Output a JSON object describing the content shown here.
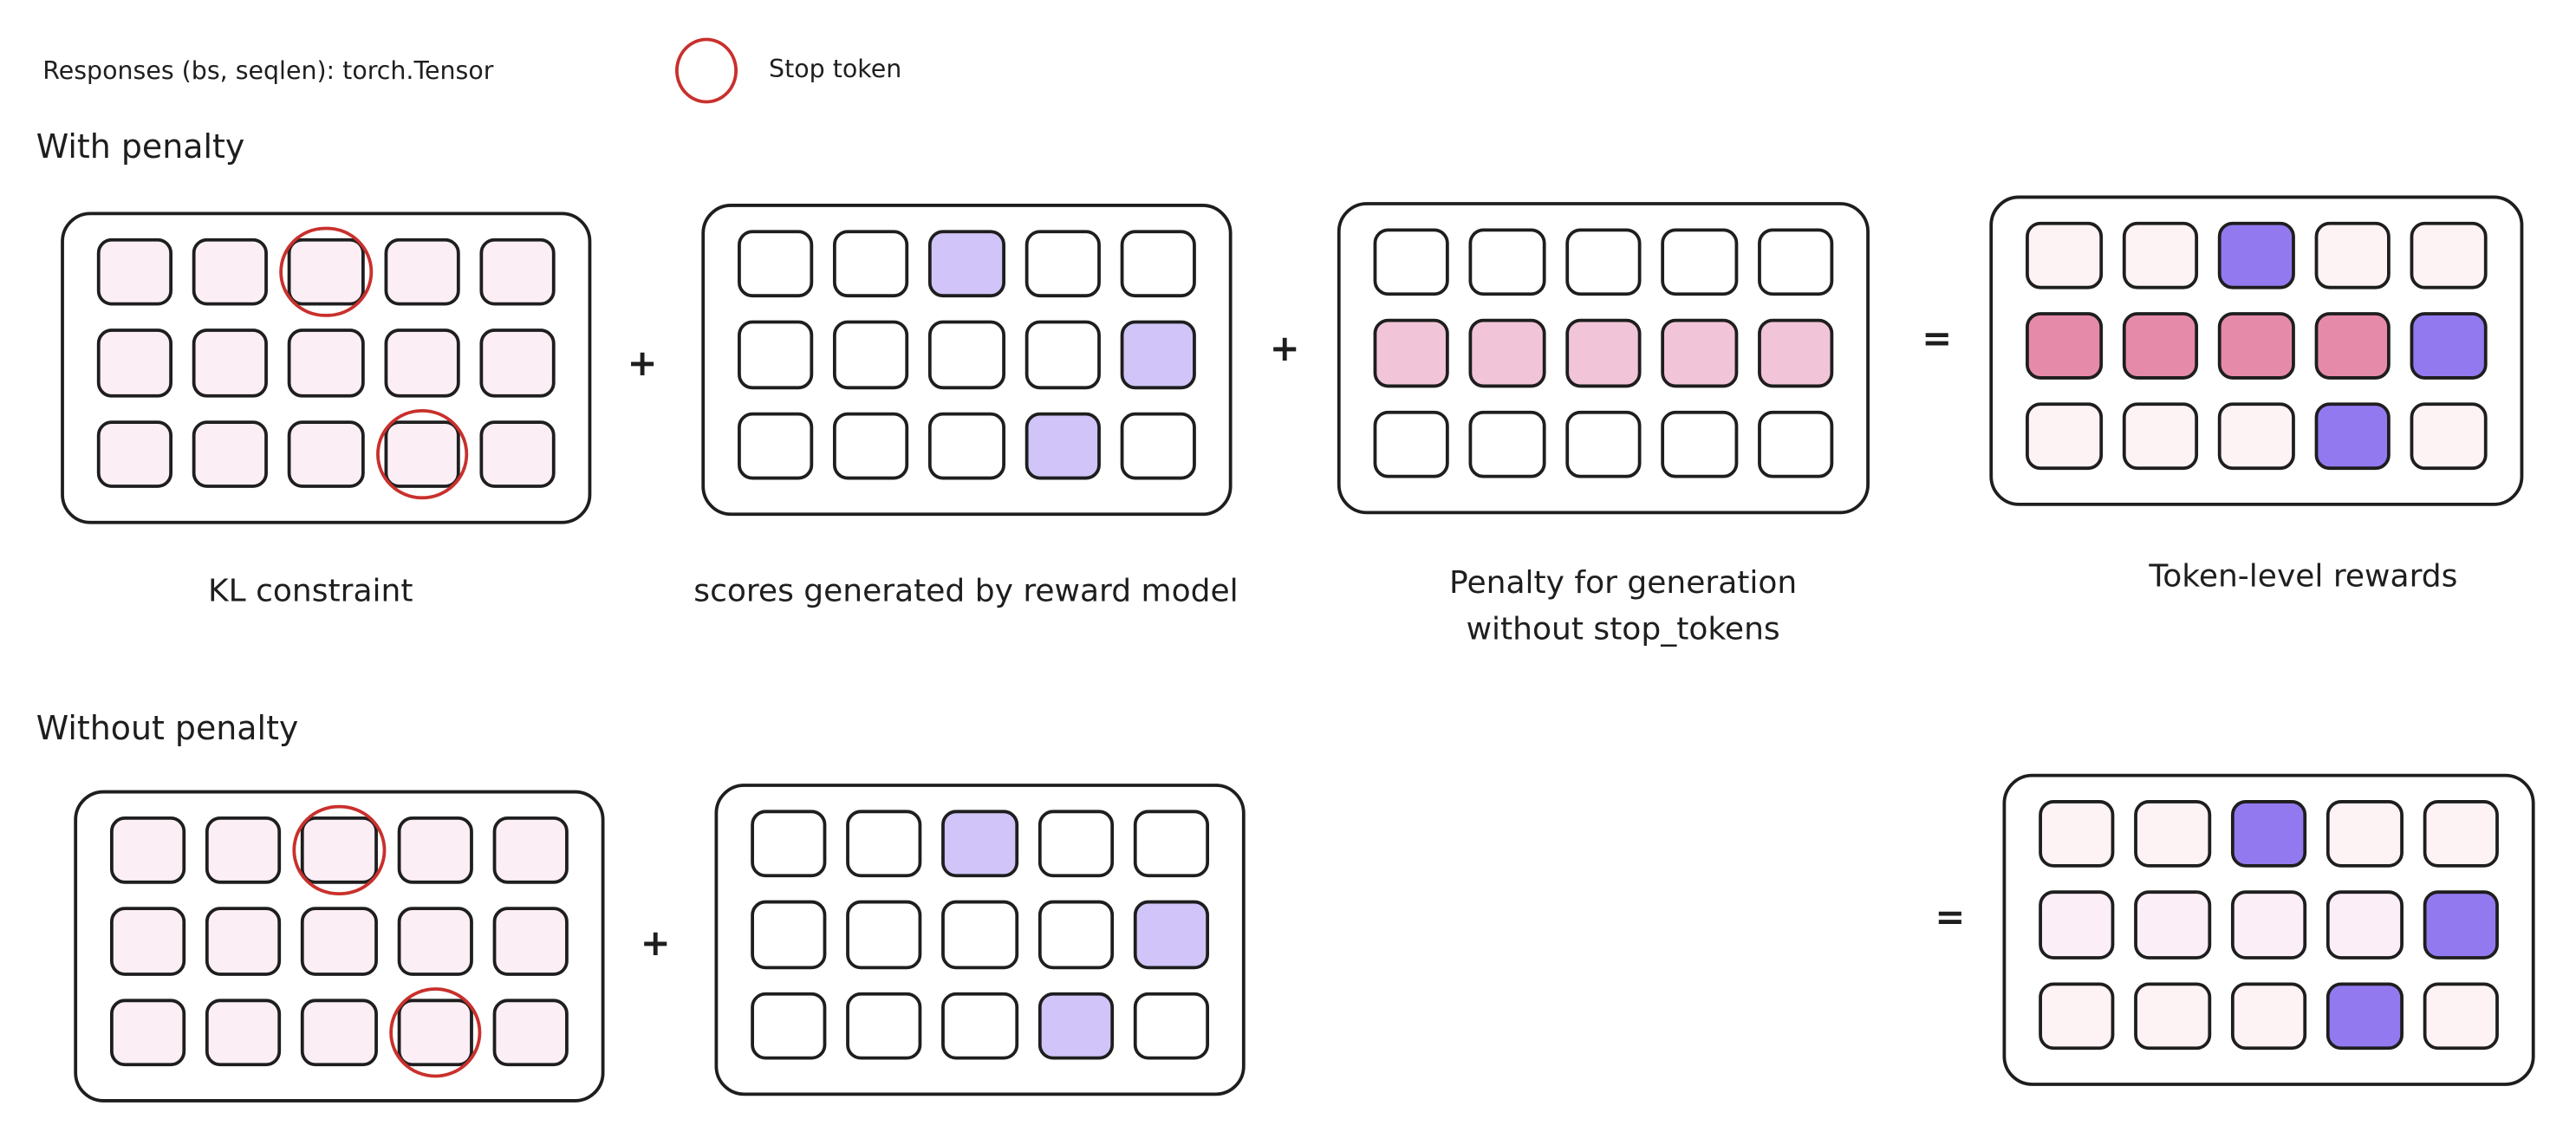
{
  "legend": {
    "responses_label": "Responses (bs, seqlen): torch.Tensor",
    "stop_token_label": "Stop token",
    "stop_token_icon": "red-circle",
    "stop_color": "#c9302c"
  },
  "colors": {
    "kl": "#fbeef5",
    "empty": "#ffffff",
    "score": "#d0c4f8",
    "penalty": "#f2c4d8",
    "reward_neg": "#e68aa9",
    "reward_pos": "#9379f0",
    "reward_small": "#fdf2f4",
    "reward_light": "#fbeef6"
  },
  "sections": [
    {
      "title": "With penalty",
      "operators": [
        "+",
        "+",
        "="
      ],
      "captions": [
        "KL constraint",
        "scores generated by reward model",
        "Penalty for generation\nwithout stop_tokens",
        "Token-level rewards"
      ],
      "grids": [
        {
          "name": "kl-constraint",
          "cells": [
            [
              "kl",
              "kl",
              "kl",
              "kl",
              "kl"
            ],
            [
              "kl",
              "kl",
              "kl",
              "kl",
              "kl"
            ],
            [
              "kl",
              "kl",
              "kl",
              "kl",
              "kl"
            ]
          ],
          "stops": [
            [
              0,
              2
            ],
            [
              2,
              3
            ]
          ]
        },
        {
          "name": "reward-model-scores",
          "cells": [
            [
              "empty",
              "empty",
              "score",
              "empty",
              "empty"
            ],
            [
              "empty",
              "empty",
              "empty",
              "empty",
              "score"
            ],
            [
              "empty",
              "empty",
              "empty",
              "score",
              "empty"
            ]
          ],
          "stops": []
        },
        {
          "name": "stop-token-penalty",
          "cells": [
            [
              "empty",
              "empty",
              "empty",
              "empty",
              "empty"
            ],
            [
              "penalty",
              "penalty",
              "penalty",
              "penalty",
              "penalty"
            ],
            [
              "empty",
              "empty",
              "empty",
              "empty",
              "empty"
            ]
          ],
          "stops": []
        },
        {
          "name": "token-level-rewards",
          "cells": [
            [
              "reward_small",
              "reward_small",
              "reward_pos",
              "reward_small",
              "reward_small"
            ],
            [
              "reward_neg",
              "reward_neg",
              "reward_neg",
              "reward_neg",
              "reward_pos"
            ],
            [
              "reward_small",
              "reward_small",
              "reward_small",
              "reward_pos",
              "reward_small"
            ]
          ],
          "stops": []
        }
      ]
    },
    {
      "title": "Without penalty",
      "operators": [
        "+",
        "="
      ],
      "captions": [],
      "grids": [
        {
          "name": "kl-constraint",
          "cells": [
            [
              "kl",
              "kl",
              "kl",
              "kl",
              "kl"
            ],
            [
              "kl",
              "kl",
              "kl",
              "kl",
              "kl"
            ],
            [
              "kl",
              "kl",
              "kl",
              "kl",
              "kl"
            ]
          ],
          "stops": [
            [
              0,
              2
            ],
            [
              2,
              3
            ]
          ]
        },
        {
          "name": "reward-model-scores",
          "cells": [
            [
              "empty",
              "empty",
              "score",
              "empty",
              "empty"
            ],
            [
              "empty",
              "empty",
              "empty",
              "empty",
              "score"
            ],
            [
              "empty",
              "empty",
              "empty",
              "score",
              "empty"
            ]
          ],
          "stops": []
        },
        {
          "name": "token-level-rewards",
          "cells": [
            [
              "reward_small",
              "reward_small",
              "reward_pos",
              "reward_small",
              "reward_small"
            ],
            [
              "reward_light",
              "reward_light",
              "reward_light",
              "reward_light",
              "reward_pos"
            ],
            [
              "reward_small",
              "reward_small",
              "reward_small",
              "reward_pos",
              "reward_small"
            ]
          ],
          "stops": []
        }
      ]
    }
  ]
}
